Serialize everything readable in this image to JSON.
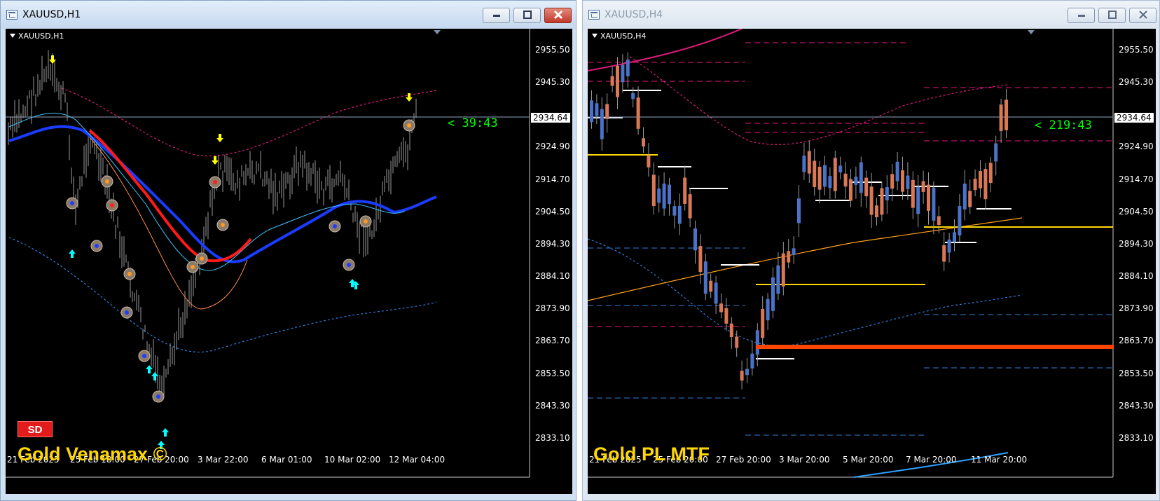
{
  "windows": {
    "left": {
      "title": "XAUUSD,H1",
      "symbol_label": "XAUUSD,H1",
      "current_price": "2934.64",
      "timer": "< 39:43",
      "badge": "SD",
      "indicator_title": "Gold Venamax ©",
      "price_axis": [
        "2955.50",
        "2945.30",
        "2934.64",
        "2924.90",
        "2914.70",
        "2904.50",
        "2894.30",
        "2884.10",
        "2873.90",
        "2863.70",
        "2853.50",
        "2843.30",
        "2833.10"
      ],
      "time_axis": [
        "21 Feb 2025",
        "25 Feb 18:00",
        "27 Feb 20:00",
        "3 Mar 22:00",
        "6 Mar 01:00",
        "10 Mar 02:00",
        "12 Mar 04:00"
      ]
    },
    "right": {
      "title": "XAUUSD,H4",
      "symbol_label": "XAUUSD,H4",
      "current_price": "2934.64",
      "timer": "< 219:43",
      "indicator_title": "Gold PL MTF",
      "price_axis": [
        "2955.50",
        "2945.30",
        "2934.64",
        "2924.90",
        "2914.70",
        "2904.50",
        "2894.30",
        "2884.10",
        "2873.90",
        "2863.70",
        "2853.50",
        "2843.30",
        "2833.10"
      ],
      "time_axis": [
        "21 Feb 2025",
        "25 Feb 20:00",
        "27 Feb 20:00",
        "3 Mar 20:00",
        "5 Mar 20:00",
        "7 Mar 20:00",
        "11 Mar 20:00"
      ]
    }
  },
  "colors": {
    "background": "#000000",
    "bull_candle": "#4a72c8",
    "bear_candle": "#d97855",
    "price_line": "#8fa4bd",
    "pink_band": "#e0197d",
    "blue_band": "#2f7bd8",
    "red_ma": "#ff1a1a",
    "blue_ma": "#1a3cff",
    "support_orange": "#ff4500",
    "gold_level": "#ffd700",
    "timer": "#00ff00",
    "indicator_title": "#ffd700",
    "badge": "#e31b1b"
  },
  "icons": {
    "minimize": "minimize-icon",
    "maximize": "maximize-icon",
    "close": "close-icon",
    "window": "chart-window-icon",
    "dropdown": "chevron-down-icon"
  }
}
